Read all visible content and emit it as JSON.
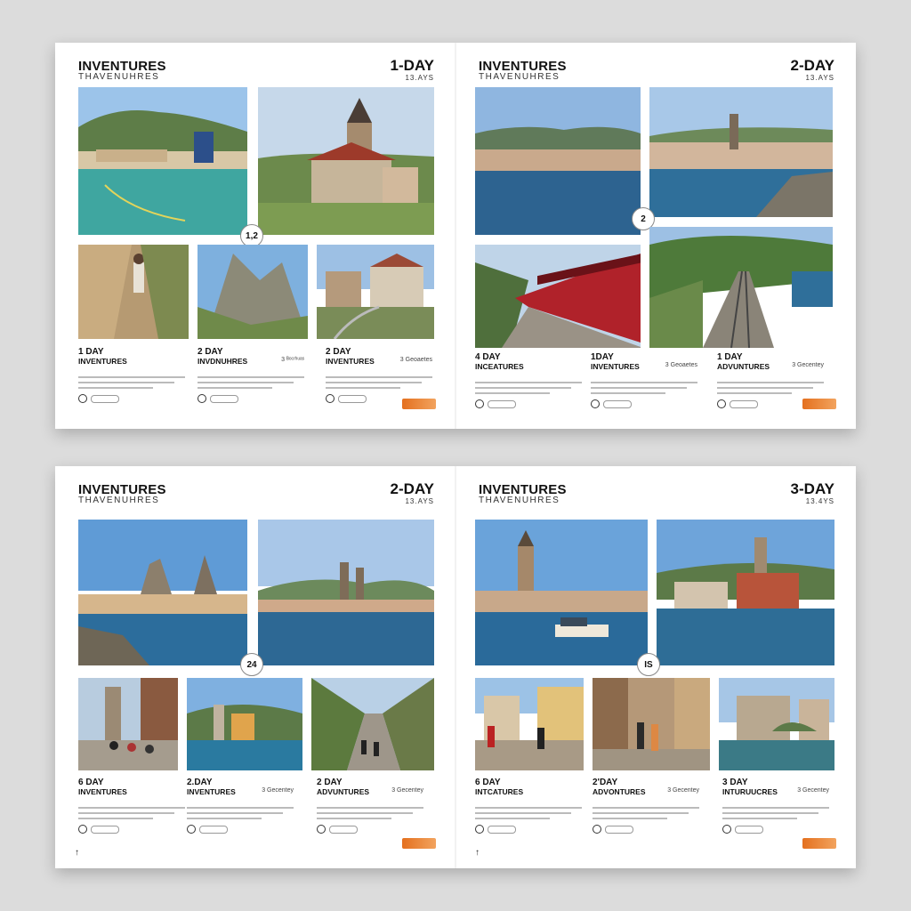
{
  "spreads": [
    {
      "pages": [
        {
          "brand": "INVENTURES",
          "brand_sub": "THAVENUHRES",
          "day_title": "1-DAY",
          "day_sub": "13.AYS",
          "badge": "1,2",
          "captions": [
            {
              "title": "1 DAY",
              "sub": "INVENTURES",
              "note": ""
            },
            {
              "title": "2 DAY",
              "sub": "INVDNUHRES",
              "note": "3 ᴮᵒᶜʳʰᵘᵃˢ"
            },
            {
              "title": "2 DAY",
              "sub": "INVENTURES",
              "note": "3 Geoaetes"
            }
          ]
        },
        {
          "brand": "INVENTURES",
          "brand_sub": "THAVENUHRES",
          "day_title": "2-DAY",
          "day_sub": "13.AYS",
          "badge": "2",
          "captions": [
            {
              "title": "4 DAY",
              "sub": "INCEATURES",
              "note": ""
            },
            {
              "title": "1DAY",
              "sub": "INVENTURES",
              "note": "3 Geoaetes"
            },
            {
              "title": "1 DAY",
              "sub": "ADVUNTURES",
              "note": "3 Gecentey"
            }
          ]
        }
      ]
    },
    {
      "pages": [
        {
          "brand": "INVENTURES",
          "brand_sub": "THAVENUHRES",
          "day_title": "2-DAY",
          "day_sub": "13.AYS",
          "badge": "24",
          "captions": [
            {
              "title": "6 DAY",
              "sub": "INVENTURES",
              "note": ""
            },
            {
              "title": "2.DAY",
              "sub": "INVENTURES",
              "note": "3 Gecentey"
            },
            {
              "title": "2 DAY",
              "sub": "ADVUNTURES",
              "note": "3 Gecentey"
            }
          ]
        },
        {
          "brand": "INVENTURES",
          "brand_sub": "THAVENUHRES",
          "day_title": "3-DAY",
          "day_sub": "13.4YS",
          "badge": "IS",
          "captions": [
            {
              "title": "6 DAY",
              "sub": "INTCATURES",
              "note": ""
            },
            {
              "title": "2'DAY",
              "sub": "ADVONTURES",
              "note": "3 Gecentey"
            },
            {
              "title": "3 DAY",
              "sub": "INTURUUCRES",
              "note": "3 Gecentey"
            }
          ]
        }
      ]
    }
  ],
  "colors": {
    "sky": "#7fb0e0",
    "sea": "#2f6f9a",
    "hill": "#5a7f45",
    "train_red": "#b0222a",
    "logo_orange": "#e4701f"
  }
}
